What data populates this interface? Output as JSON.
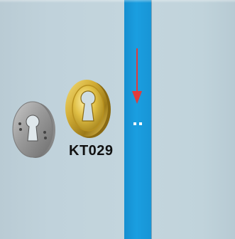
{
  "product": {
    "code": "KT029"
  },
  "colors": {
    "panel": "#c2d4dc",
    "stripe": "#1a9ee0",
    "arrow": "#e23b3b",
    "gold": "#c9a227",
    "silver": "#8c8c8c",
    "label": "#111111"
  },
  "icons": {
    "arrow": "down-arrow-icon",
    "silver_rose": "silver-cylinder-rose",
    "gold_rose": "brass-cylinder-rose"
  }
}
